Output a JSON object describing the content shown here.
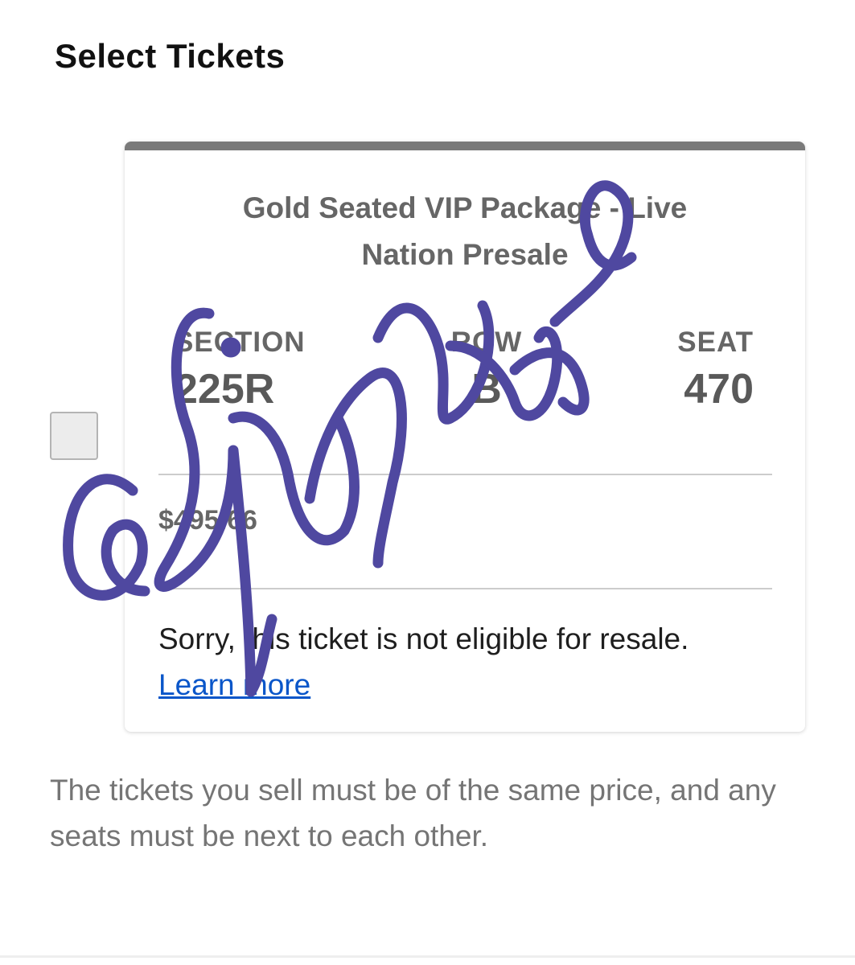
{
  "page": {
    "title": "Select Tickets"
  },
  "ticket": {
    "name": "Gold Seated VIP Package - Live Nation Presale",
    "section_label": "SECTION",
    "section_value": "225R",
    "row_label": "ROW",
    "row_value": "B",
    "seat_label": "SEAT",
    "seat_value": "470",
    "price": "$495.66",
    "notice_text": "Sorry, this ticket is not eligible for resale.",
    "learn_more_label": "Learn more",
    "selected": false
  },
  "footnote": "The tickets you sell must be of the same price, and any seats must be next to each other.",
  "signature_overlay": {
    "text": "@fangirltangent",
    "color": "#4f48a0"
  },
  "colors": {
    "link": "#0a56c9",
    "card_top_bar": "#7a7a7a",
    "checkbox_fill": "#ececec"
  }
}
